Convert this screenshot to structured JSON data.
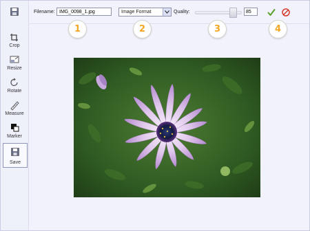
{
  "toolbar": {
    "filename_label": "Filename:",
    "filename_value": "IMG_0098_1.jpg",
    "format_selected": "Image Format",
    "quality_label": "Quality:",
    "quality_value": "85",
    "quality_level_percent": 85
  },
  "sidebar": {
    "tools": [
      {
        "label": "Crop",
        "icon": "crop-icon"
      },
      {
        "label": "Resize",
        "icon": "resize-icon"
      },
      {
        "label": "Rotate",
        "icon": "rotate-icon"
      },
      {
        "label": "Measure",
        "icon": "ruler-icon"
      },
      {
        "label": "Marker",
        "icon": "marker-icon"
      },
      {
        "label": "Save",
        "icon": "save-icon"
      }
    ]
  },
  "callouts": [
    "1",
    "2",
    "3",
    "4"
  ],
  "colors": {
    "accent_orange": "#f5a623",
    "ok_green": "#5aa02c",
    "cancel_red": "#d9372b",
    "panel_bg": "#f1f2fb"
  }
}
